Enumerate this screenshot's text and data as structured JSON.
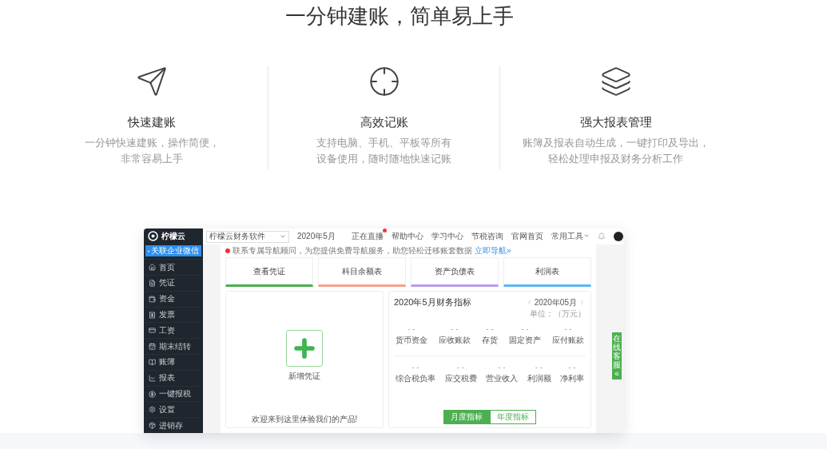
{
  "headline": "一分钟建账，简单易上手",
  "features": [
    {
      "title": "快速建账",
      "lines": [
        "一分钟快速建账，操作简便，",
        "非常容易上手"
      ]
    },
    {
      "title": "高效记账",
      "lines": [
        "支持电脑、手机、平板等所有",
        "设备使用，随时随地快速记账"
      ]
    },
    {
      "title": "强大报表管理",
      "lines": [
        "账簿及报表自动生成，一键打印及导出，",
        "轻松处理申报及财务分析工作"
      ]
    }
  ],
  "app": {
    "brand": "柠檬云",
    "account_select": "柠檬云财务软件",
    "period": "2020年5月",
    "top_links": [
      {
        "label": "正在直播",
        "live_dot": true
      },
      {
        "label": "帮助中心",
        "live_dot": false
      },
      {
        "label": "学习中心",
        "live_dot": false
      },
      {
        "label": "节税咨询",
        "live_dot": false
      },
      {
        "label": "官网首页",
        "live_dot": false
      }
    ],
    "tools_menu": "常用工具",
    "wechat_button": "关联企业微信",
    "sidebar": [
      {
        "label": "首页"
      },
      {
        "label": "凭证"
      },
      {
        "label": "资金"
      },
      {
        "label": "发票"
      },
      {
        "label": "工资"
      },
      {
        "label": "期末结转"
      },
      {
        "label": "账簿"
      },
      {
        "label": "报表"
      },
      {
        "label": "一键报税"
      },
      {
        "label": "设置"
      },
      {
        "label": "进销存"
      }
    ],
    "notice": {
      "text": "联系专属导航顾问，为您提供免费导航服务，助您轻松迁移账套数据",
      "link": "立即导航»"
    },
    "quick_cards": [
      {
        "label": "查看凭证",
        "color": "#4caf50"
      },
      {
        "label": "科目余额表",
        "color": "#f8a08a"
      },
      {
        "label": "资产负债表",
        "color": "#b79cec"
      },
      {
        "label": "利润表",
        "color": "#5cb6f2"
      }
    ],
    "new_voucher": "新增凭证",
    "welcome": "欢迎来到这里体验我们的产品!",
    "indicators": {
      "title": "2020年5月财务指标",
      "period": "2020年05月",
      "unit": "单位：（万元）",
      "rows": [
        [
          {
            "value": "- -",
            "label": "货币资金"
          },
          {
            "value": "- -",
            "label": "应收账款"
          },
          {
            "value": "- -",
            "label": "存货"
          },
          {
            "value": "- -",
            "label": "固定资产"
          },
          {
            "value": "- -",
            "label": "应付账款"
          }
        ],
        [
          {
            "value": "- -",
            "label": "综合税负率"
          },
          {
            "value": "- -",
            "label": "应交税费"
          },
          {
            "value": "- -",
            "label": "营业收入"
          },
          {
            "value": "- -",
            "label": "利润额"
          },
          {
            "value": "- -",
            "label": "净利率"
          }
        ]
      ],
      "tabs": [
        {
          "label": "月度指标",
          "selected": true
        },
        {
          "label": "年度指标",
          "selected": false
        }
      ]
    },
    "service_tab": "在线客服",
    "service_arrow": "«"
  }
}
